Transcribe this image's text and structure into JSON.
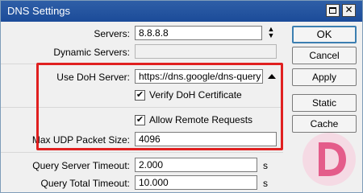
{
  "window": {
    "title": "DNS Settings"
  },
  "fields": {
    "servers": {
      "label": "Servers:",
      "value": "8.8.8.8"
    },
    "dynamic_servers": {
      "label": "Dynamic Servers:",
      "value": ""
    },
    "use_doh_server": {
      "label": "Use DoH Server:",
      "value": "https://dns.google/dns-query"
    },
    "verify_doh_certificate": {
      "label": "Verify DoH Certificate",
      "checked": true
    },
    "allow_remote_requests": {
      "label": "Allow Remote Requests",
      "checked": true
    },
    "max_udp_packet_size": {
      "label": "Max UDP Packet Size:",
      "value": "4096"
    },
    "query_server_timeout": {
      "label": "Query Server Timeout:",
      "value": "2.000",
      "unit": "s"
    },
    "query_total_timeout": {
      "label": "Query Total Timeout:",
      "value": "10.000",
      "unit": "s"
    }
  },
  "buttons": {
    "ok": "OK",
    "cancel": "Cancel",
    "apply": "Apply",
    "static": "Static",
    "cache": "Cache"
  },
  "checkmark": "✔",
  "colors": {
    "titlebar": "#1f4f9d",
    "highlight": "#e02020",
    "watermark": "#e0457a"
  }
}
